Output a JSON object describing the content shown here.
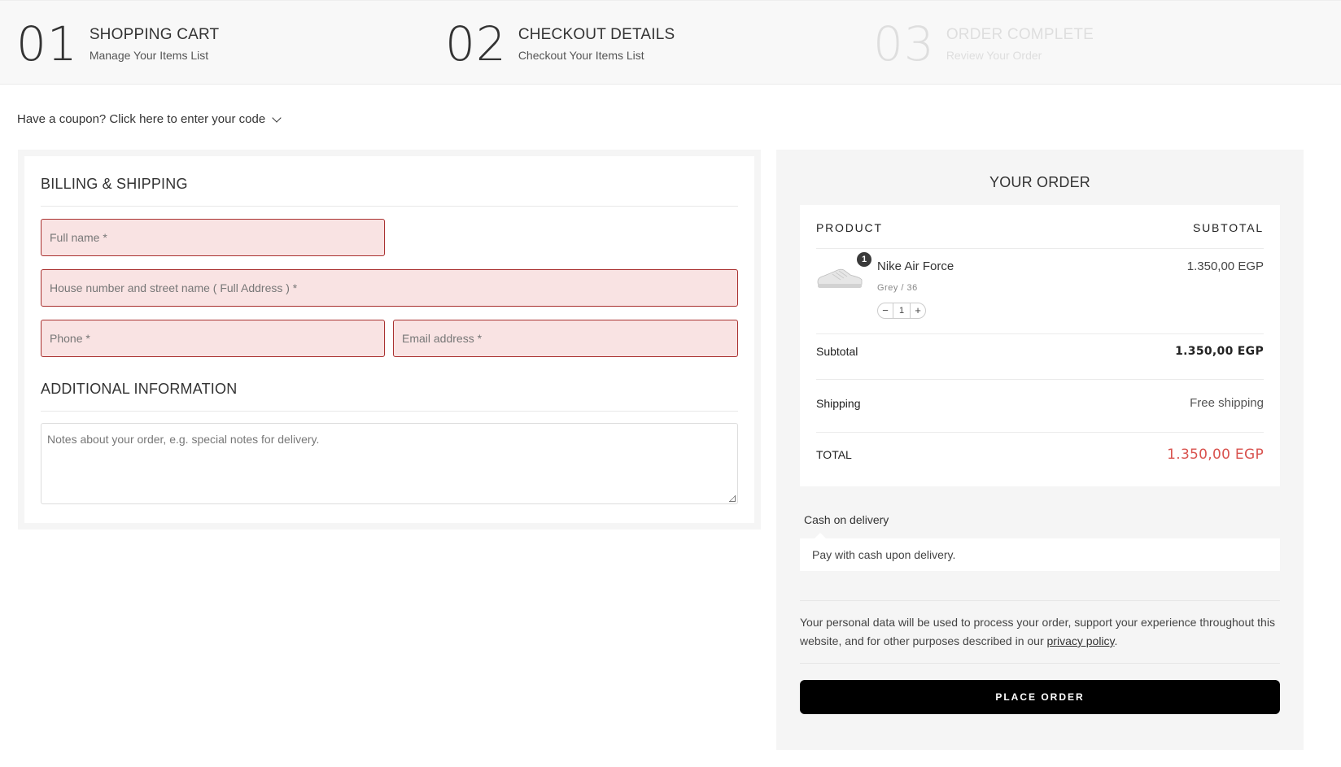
{
  "steps": [
    {
      "num": "01",
      "title": "SHOPPING CART",
      "subtitle": "Manage Your Items List"
    },
    {
      "num": "02",
      "title": "CHECKOUT DETAILS",
      "subtitle": "Checkout Your Items List"
    },
    {
      "num": "03",
      "title": "ORDER COMPLETE",
      "subtitle": "Review Your Order"
    }
  ],
  "coupon": {
    "text": "Have a coupon? Click here to enter your code"
  },
  "billing": {
    "title": "BILLING & SHIPPING",
    "fields": {
      "full_name": "Full name *",
      "address": "House number and street name ( Full Address ) *",
      "phone": "Phone *",
      "email": "Email address *"
    },
    "additional_title": "ADDITIONAL INFORMATION",
    "notes_placeholder": "Notes about your order, e.g. special notes for delivery."
  },
  "order": {
    "title": "YOUR ORDER",
    "col_product": "PRODUCT",
    "col_subtotal": "SUBTOTAL",
    "item": {
      "name": "Nike Air Force",
      "variant": "Grey / 36",
      "price": "1.350,00 EGP",
      "quantity": "1",
      "badge": "1"
    },
    "subtotal_label": "Subtotal",
    "subtotal_value": "1.350,00 EGP",
    "shipping_label": "Shipping",
    "shipping_value": "Free shipping",
    "total_label": "TOTAL",
    "total_value": "1.350,00 EGP",
    "payment_method": "Cash on delivery",
    "payment_desc": "Pay with cash upon delivery.",
    "privacy_text": "Your personal data will be used to process your order, support your experience throughout this website, and for other purposes described in our ",
    "privacy_link": "privacy policy",
    "privacy_end": ".",
    "place_order": "PLACE ORDER"
  },
  "colors": {
    "accent_total": "#d9534f",
    "error_border": "#a9302f",
    "error_bg": "#f9e3e3"
  }
}
